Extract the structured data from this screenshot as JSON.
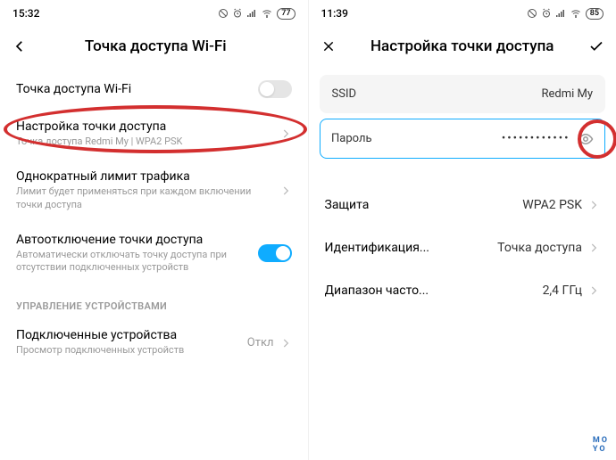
{
  "left": {
    "status": {
      "time": "15:32",
      "battery": "77"
    },
    "header": {
      "title": "Точка доступа Wi-Fi"
    },
    "rows": {
      "hotspot": {
        "title": "Точка доступа Wi-Fi"
      },
      "setup": {
        "title": "Настройка точки доступа",
        "sub": "Точка доступа Redmi My | WPA2 PSK"
      },
      "limit": {
        "title": "Однократный лимит трафика",
        "sub": "Лимит будет применяться при каждом включении точки доступа"
      },
      "autooff": {
        "title": "Автоотключение точки доступа",
        "sub": "Автоматически отключать точку доступа при отсутствии подключенных устройств"
      }
    },
    "section": "УПРАВЛЕНИЕ УСТРОЙСТВАМИ",
    "connected": {
      "title": "Подключенные устройства",
      "sub": "Просмотр подключенных устройств",
      "value": "Откл"
    }
  },
  "right": {
    "status": {
      "time": "11:39",
      "battery": "85"
    },
    "header": {
      "title": "Настройка точки доступа"
    },
    "ssid": {
      "label": "SSID",
      "value": "Redmi My"
    },
    "password": {
      "label": "Пароль",
      "value": "••••••••••••"
    },
    "rows": {
      "security": {
        "label": "Защита",
        "value": "WPA2 PSK"
      },
      "ident": {
        "label": "Идентификация...",
        "value": "Точка доступа"
      },
      "band": {
        "label": "Диапазон часто...",
        "value": "2,4 ГГц"
      }
    }
  },
  "brand": {
    "l1": "MO",
    "l2": "YO"
  }
}
